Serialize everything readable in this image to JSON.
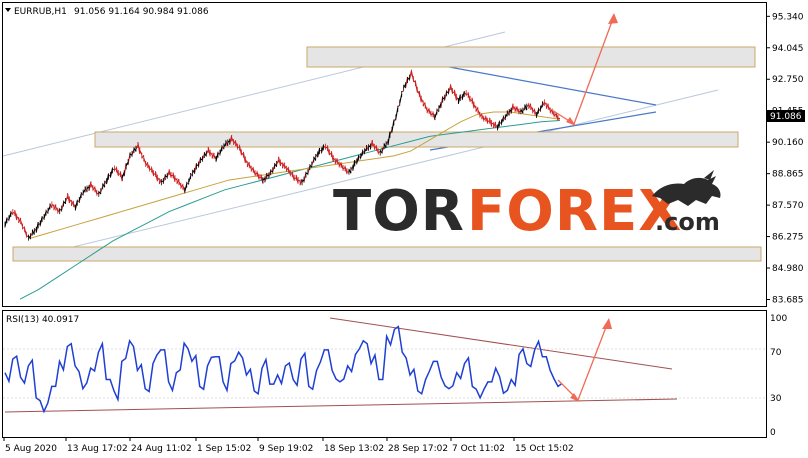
{
  "header": {
    "symbol": "EURRUB,H1",
    "ohlc": "91.056 91.164 90.984 91.086"
  },
  "rsi_header": "RSI(13) 40.0917",
  "price_tag": "91.086",
  "logo": {
    "part1": "TOR",
    "part2": "FOREX",
    "suffix": ".com"
  },
  "colors": {
    "price_line": "#000000",
    "candle_up": "#000000",
    "candle_down": "#cc1f1f",
    "ma_fast": "#c8a23c",
    "ma_slow": "#2a9d8f",
    "trend_blue": "#4a78c9",
    "channel": "#b8c8dc",
    "zone_fill": "#e5e5e5",
    "zone_border": "#c9a86a",
    "forecast": "#f06a55",
    "rsi_line": "#1f3fd4",
    "rsi_trend": "#a05050"
  },
  "chart_data": [
    {
      "type": "line",
      "title": "EURRUB,H1",
      "y_ticks": [
        95.34,
        94.045,
        92.75,
        91.455,
        90.16,
        88.865,
        87.57,
        86.275,
        84.98,
        83.685
      ],
      "y_tick_labels": [
        "95.340",
        "94.045",
        "92.750",
        "91.455",
        "90.160",
        "88.865",
        "87.570",
        "86.275",
        "84.980",
        "83.685"
      ],
      "ylim": [
        83.5,
        95.6
      ],
      "x_tick_labels": [
        "5 Aug 2020",
        "13 Aug 17:02",
        "24 Aug 11:02",
        "1 Sep 15:02",
        "9 Sep 19:02",
        "18 Sep 13:02",
        "28 Sep 17:02",
        "7 Oct 11:02",
        "15 Oct 15:02"
      ],
      "series": [
        {
          "values": [
            86.8,
            87.3,
            86.9,
            86.2,
            86.6,
            87.1,
            87.6,
            87.3,
            87.9,
            87.5,
            88.1,
            88.4,
            88.0,
            88.6,
            89.1,
            88.7,
            89.6,
            90.0,
            89.3,
            88.9,
            88.5,
            88.9,
            88.6,
            88.2,
            88.9,
            89.4,
            89.8,
            89.5,
            90.0,
            90.3,
            89.9,
            89.3,
            88.9,
            88.6,
            88.9,
            89.4,
            89.1,
            88.7,
            88.5,
            89.1,
            89.7,
            90.0,
            89.5,
            89.2,
            88.9,
            89.4,
            89.8,
            90.1,
            89.7,
            90.2,
            91.2,
            92.4,
            93.0,
            92.1,
            91.5,
            91.2,
            91.9,
            92.4,
            91.9,
            92.2,
            91.7,
            91.2,
            91.0,
            90.8,
            91.2,
            91.6,
            91.4,
            91.7,
            91.3,
            91.8,
            91.4,
            91.1
          ]
        },
        {
          "name": "",
          "values": [
            86.2,
            86.4,
            86.6,
            86.8,
            87.0,
            87.2,
            87.4,
            87.6,
            87.8,
            88.0,
            88.2,
            88.4,
            88.6,
            88.7,
            88.8,
            88.9,
            89.0,
            89.1,
            89.2,
            89.3,
            89.4,
            89.5,
            89.6,
            89.8,
            90.2,
            90.6,
            91.0,
            91.3,
            91.4,
            91.4,
            91.3,
            91.2,
            91.1
          ]
        },
        {
          "name": "",
          "values": [
            83.7,
            84.1,
            84.6,
            85.1,
            85.6,
            86.1,
            86.5,
            86.9,
            87.3,
            87.6,
            87.9,
            88.2,
            88.4,
            88.6,
            88.8,
            89.0,
            89.2,
            89.4,
            89.6,
            89.8,
            90.0,
            90.2,
            90.4,
            90.5,
            90.6,
            90.7,
            90.8,
            90.9,
            91.0,
            91.05
          ]
        }
      ],
      "zones": [
        [
          93.7,
          94.35
        ],
        [
          90.0,
          90.45
        ],
        [
          85.6,
          86.0
        ]
      ],
      "forecast_target": 95.0
    },
    {
      "type": "line",
      "title": "RSI(13) 40.0917",
      "y_ticks": [
        100,
        70,
        30,
        0
      ],
      "y_tick_labels": [
        "100",
        "70",
        "30",
        "0"
      ],
      "ylim": [
        0,
        100
      ],
      "series": [
        {
          "name": "RSI(13)",
          "values": [
            52,
            64,
            48,
            58,
            30,
            18,
            40,
            62,
            75,
            58,
            38,
            56,
            70,
            46,
            36,
            62,
            80,
            54,
            38,
            60,
            72,
            44,
            52,
            78,
            62,
            40,
            58,
            66,
            44,
            60,
            70,
            50,
            36,
            56,
            42,
            50,
            58,
            46,
            64,
            40,
            54,
            72,
            54,
            44,
            58,
            68,
            80,
            60,
            46,
            84,
            90,
            70,
            50,
            36,
            46,
            62,
            48,
            38,
            52,
            60,
            40,
            30,
            44,
            56,
            34,
            46,
            68,
            60,
            72,
            66,
            54,
            40
          ]
        }
      ]
    }
  ]
}
